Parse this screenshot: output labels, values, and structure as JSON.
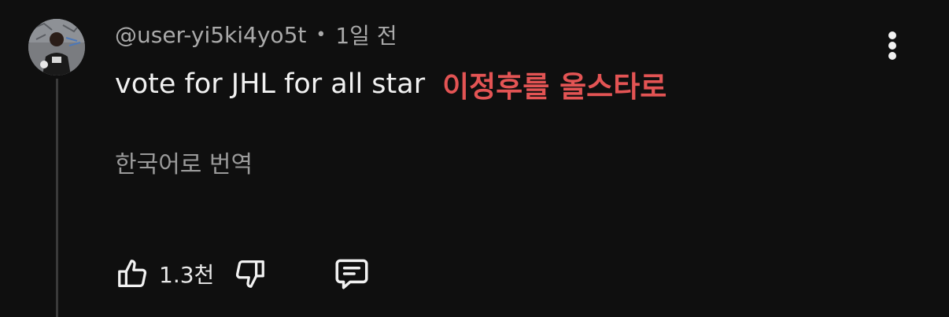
{
  "comment": {
    "author": "@user-yi5ki4yo5t",
    "separator": "•",
    "time": "1일 전",
    "text_main": "vote for JHL for all star",
    "text_emphasis": "이정후를 올스타로",
    "translate_label": "한국어로 번역",
    "like_count": "1.3천"
  },
  "icons": {
    "more": "more-vertical-icon",
    "like": "thumbs-up-icon",
    "dislike": "thumbs-down-icon",
    "reply": "comment-reply-icon"
  },
  "colors": {
    "background": "#0f0f0f",
    "emphasis_text": "#e35454",
    "secondary_text": "#aaaaaa"
  }
}
